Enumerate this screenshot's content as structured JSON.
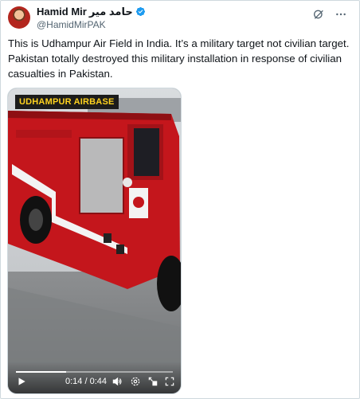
{
  "author": {
    "display_name": "Hamid Mir",
    "urdu_name": "حامد میر",
    "handle": "@HamidMirPAK",
    "verified": true
  },
  "tweet": {
    "text": "This is Udhampur Air Field in India. It’s a military target not civilian target. Pakistan totally destroyed this military installation in response of civilian casualties in Pakistan."
  },
  "media": {
    "overlay_text": "UDHAMPUR AIRBASE",
    "time_display": "0:14 / 0:44",
    "progress": 0.318
  },
  "icons": {
    "verified": "verified-badge-icon",
    "grok": "grok-icon",
    "more": "more-icon",
    "play": "play-icon",
    "volume": "volume-icon",
    "settings": "settings-icon",
    "pip": "picture-in-picture-icon",
    "fullscreen": "fullscreen-icon"
  },
  "colors": {
    "verified_blue": "#1d9bf0",
    "truck_red": "#c4161c",
    "overlay_yellow": "#ffd21f"
  }
}
